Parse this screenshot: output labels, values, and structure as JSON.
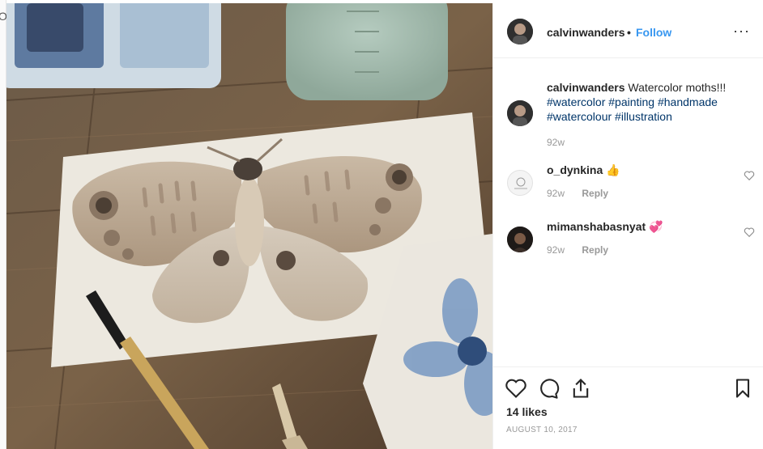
{
  "post": {
    "username": "calvinwanders",
    "separator": "•",
    "follow_label": "Follow",
    "more_icon": "···",
    "caption": {
      "username": "calvinwanders",
      "text": "Watercolor moths!!!",
      "hashtags": [
        "#watercolor",
        "#painting",
        "#handmade",
        "#watercolour",
        "#illustration"
      ],
      "time": "92w"
    },
    "comments": [
      {
        "username": "o_dynkina",
        "emoji": "👍",
        "time": "92w",
        "reply_label": "Reply"
      },
      {
        "username": "mimanshabasnyat",
        "emoji": "💞",
        "time": "92w",
        "reply_label": "Reply"
      }
    ],
    "likes": "14 likes",
    "date": "AUGUST 10, 2017"
  },
  "edge_glyph": "Ol",
  "colors": {
    "link_blue": "#3897f0",
    "hashtag": "#003569",
    "muted": "#999999",
    "text": "#262626"
  },
  "icons": [
    "heart-icon",
    "comment-icon",
    "share-icon",
    "bookmark-icon",
    "more-options-icon"
  ]
}
